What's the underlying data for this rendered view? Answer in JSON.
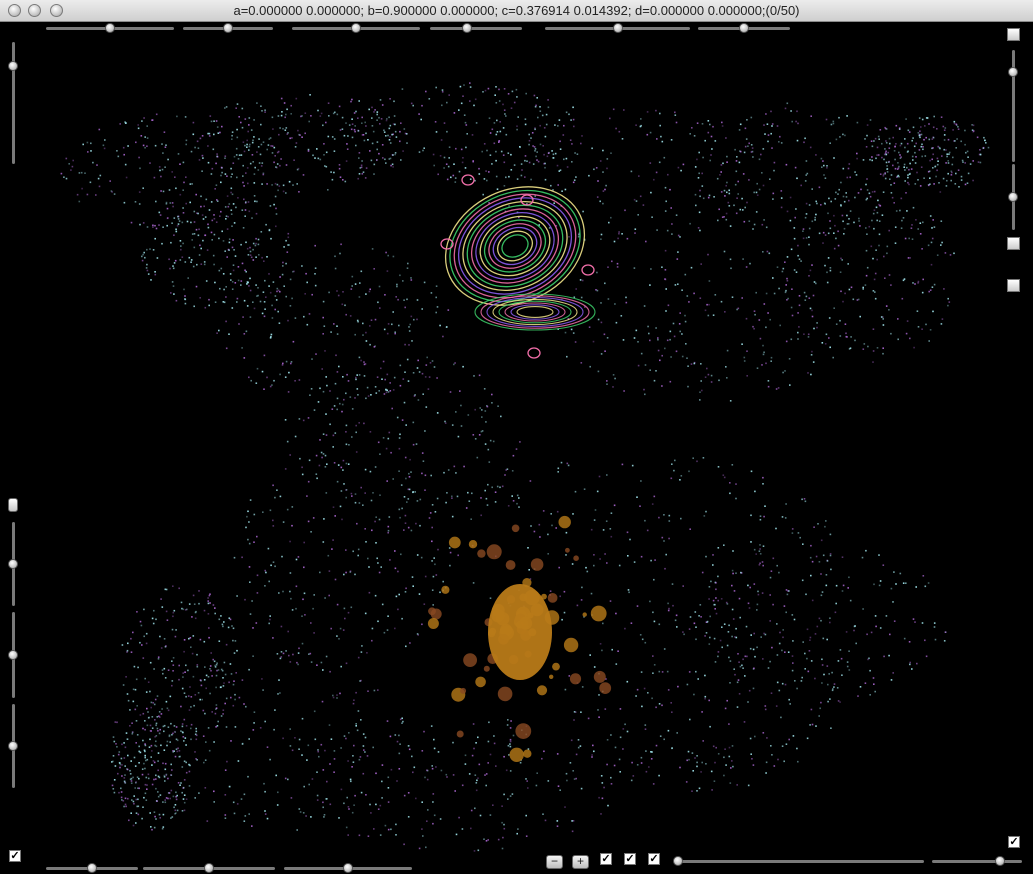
{
  "window": {
    "title": "a=0.000000 0.000000; b=0.900000 0.000000; c=0.376914 0.014392; d=0.000000 0.000000;(0/50)"
  },
  "controls": {
    "minus_label": "−",
    "plus_label": "+",
    "check_mark": "✓",
    "sliders": {
      "top_1": 0.5,
      "top_2": 0.5,
      "top_3": 0.5,
      "top_4": 0.4,
      "top_5": 0.5,
      "top_6": 0.5,
      "bottom_1": 0.5,
      "bottom_2": 0.5,
      "bottom_3": 0.5,
      "bottom_4": 0.0,
      "bottom_5": 0.75,
      "left_1": 0.8,
      "left_2": 0.5,
      "left_3": 0.5,
      "left_4": 0.5,
      "right_1": 0.8,
      "right_2": 0.5
    },
    "checkboxes": {
      "bottom_1": true,
      "bottom_2": true,
      "bottom_3": true,
      "bottom_left": true,
      "bottom_right": true
    }
  },
  "colors": {
    "background": "#000000",
    "speckle_cyan": "#a8f0f8",
    "speckle_purple": "#b06ad8",
    "orbit_yellow": "#f2e48a",
    "orbit_green": "#3ccf6a",
    "orbit_pink": "#f06ea8",
    "orbit_purple": "#8a5cf0",
    "cluster_orange": "#b87a18",
    "cluster_brown": "#8a4a22"
  }
}
